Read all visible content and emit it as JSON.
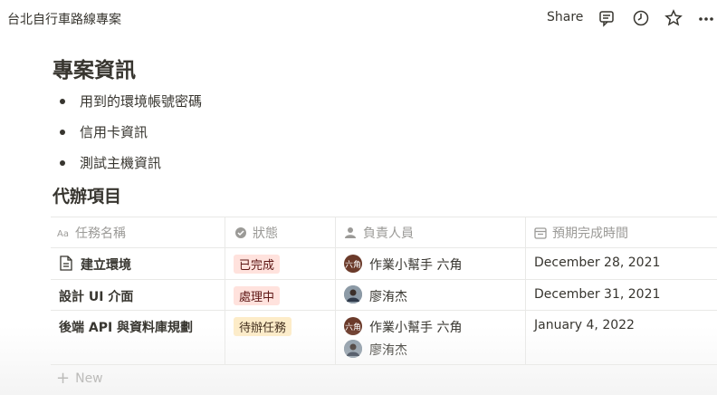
{
  "topbar": {
    "title": "台北自行車路線專案",
    "share_label": "Share",
    "icons": [
      "comment-icon",
      "clock-icon",
      "star-icon",
      "more-icon"
    ]
  },
  "page": {
    "heading": "專案資訊",
    "bullets": [
      "用到的環境帳號密碼",
      "信用卡資訊",
      "測試主機資訊"
    ],
    "subheading": "代辦項目"
  },
  "table": {
    "columns": [
      {
        "label": "任務名稱",
        "icon": "text-property-icon"
      },
      {
        "label": "狀態",
        "icon": "status-icon"
      },
      {
        "label": "負責人員",
        "icon": "person-icon"
      },
      {
        "label": "預期完成時間",
        "icon": "calendar-icon"
      }
    ],
    "rows": [
      {
        "name": "建立環境",
        "has_page_icon": true,
        "status": "已完成",
        "status_bg": "#ffe2dd",
        "status_fg": "#5d1715",
        "assignees": [
          {
            "name": "作業小幫手 六角",
            "avatar_text": "六角"
          }
        ],
        "date": "December 28, 2021"
      },
      {
        "name": "設計 UI 介面",
        "has_page_icon": false,
        "status": "處理中",
        "status_bg": "#ffe2dd",
        "status_fg": "#5d1715",
        "assignees": [
          {
            "name": "廖洧杰",
            "avatar_text": ""
          }
        ],
        "date": "December 31, 2021"
      },
      {
        "name": "後端 API 與資料庫規劃",
        "has_page_icon": false,
        "status": "待辦任務",
        "status_bg": "#fdecc8",
        "status_fg": "#402c1b",
        "assignees": [
          {
            "name": "作業小幫手 六角",
            "avatar_text": "六角"
          },
          {
            "name": "廖洧杰",
            "avatar_text": ""
          }
        ],
        "date": "January 4, 2022"
      }
    ],
    "new_label": "New"
  }
}
